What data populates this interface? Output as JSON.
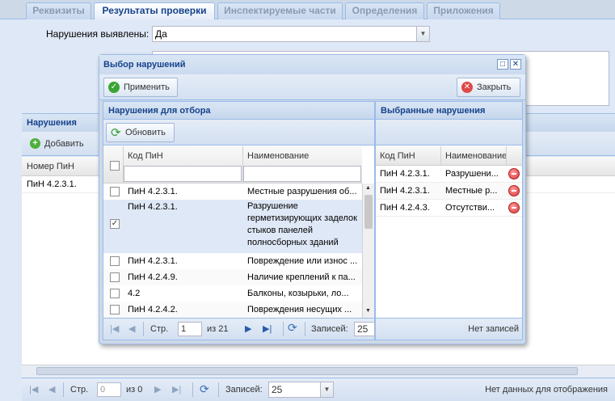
{
  "tabs": [
    "Реквизиты",
    "Результаты проверки",
    "Инспектируемые части",
    "Определения",
    "Приложения"
  ],
  "form": {
    "violations_label": "Нарушения выявлены:",
    "violations_value": "Да"
  },
  "violations_section": {
    "title": "Нарушения",
    "add_label": "Добавить",
    "column_number": "Номер ПиН",
    "rows": [
      "ПиН 4.2.3.1."
    ]
  },
  "bottom_pager": {
    "page_label": "Стр.",
    "page_value": "0",
    "of_label": "из 0",
    "records_label": "Записей:",
    "records_value": "25",
    "status": "Нет данных для отображения"
  },
  "dialog": {
    "title": "Выбор нарушений",
    "apply_label": "Применить",
    "close_label": "Закрыть",
    "left": {
      "title": "Нарушения для отбора",
      "refresh_label": "Обновить",
      "col_code": "Код ПиН",
      "col_name": "Наименование",
      "rows": [
        {
          "code": "ПиН 4.2.3.1.",
          "name": "Местные разрушения об...",
          "checked": false
        },
        {
          "code": "ПиН 4.2.3.1.",
          "name": "Разрушение герметизирующих заделок стыков панелей полносборных зданий",
          "checked": true
        },
        {
          "code": "ПиН 4.2.3.1.",
          "name": "Повреждение или износ ...",
          "checked": false
        },
        {
          "code": "ПиН 4.2.4.9.",
          "name": "Наличие креплений к па...",
          "checked": false
        },
        {
          "code": "4.2",
          "name": "Балконы, козырьки, ло...",
          "checked": false
        },
        {
          "code": "ПиН 4.2.4.2.",
          "name": "Повреждения несущих ...",
          "checked": false
        }
      ],
      "pager": {
        "page_label": "Стр.",
        "page_value": "1",
        "of_label": "из 21",
        "records_label": "Записей:",
        "records_value": "25"
      }
    },
    "right": {
      "title": "Выбранные нарушения",
      "col_code": "Код ПиН",
      "col_name": "Наименование",
      "rows": [
        {
          "code": "ПиН 4.2.3.1.",
          "name": "Разрушени..."
        },
        {
          "code": "ПиН 4.2.3.1.",
          "name": "Местные р..."
        },
        {
          "code": "ПиН 4.2.4.3.",
          "name": "Отсутстви..."
        }
      ],
      "status": "Нет записей"
    }
  },
  "colors": {
    "header_text": "#15428b",
    "panel_bg": "#dfe8f6",
    "selected_row": "#dfe8f6"
  }
}
